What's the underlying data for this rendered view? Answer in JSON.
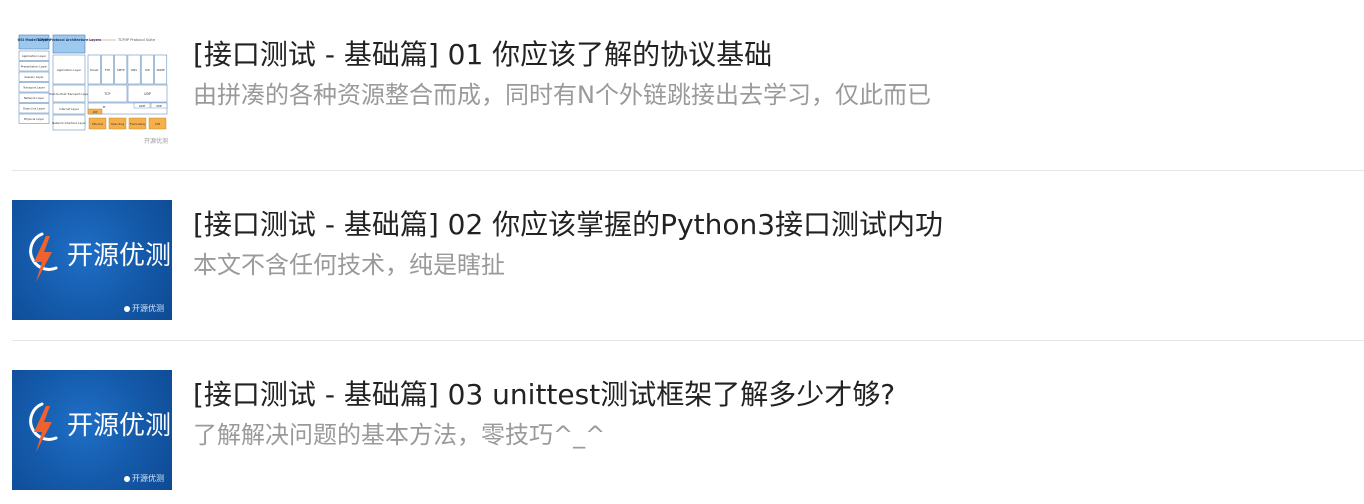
{
  "articles": [
    {
      "title": "[接口测试 - 基础篇] 01 你应该了解的协议基础",
      "description": "由拼凑的各种资源整合而成，同时有N个外链跳接出去学习，仅此而已",
      "thumbnail": {
        "kind": "protocol-diagram",
        "osi_header": "OSI Model Layers",
        "tcpip_header": "TCP/IP Protocol Architecture Layers",
        "suite_header": "TCP/IP Protocol Suite",
        "watermark": "开源优测",
        "osi_layers": [
          "Application Layer",
          "Presentation Layer",
          "Session Layer",
          "Transport Layer",
          "Network Layer",
          "Data-Link Layer",
          "Physical Layer"
        ],
        "tcpip_layers": [
          "Application Layer",
          "Host-to-Host Transport Layer",
          "Internet Layer",
          "Network Interface Layer"
        ],
        "app_protocols": [
          "Telnet",
          "FTP",
          "SMTP",
          "DNS",
          "RIP",
          "SNMP"
        ],
        "transport_protocols": [
          "TCP",
          "UDP"
        ],
        "internet_protocols": [
          "IP",
          "IGMP",
          "ICMP",
          "ARP"
        ],
        "link_protocols": [
          "Ethernet",
          "Token Ring",
          "Frame Relay",
          "ATM"
        ]
      }
    },
    {
      "title": "[接口测试 - 基础篇] 02 你应该掌握的Python3接口测试内功",
      "description": "本文不含任何技术，纯是瞎扯",
      "thumbnail": {
        "kind": "brand",
        "brand_name": "开源优测",
        "tag": "开源优测"
      }
    },
    {
      "title": "[接口测试 - 基础篇] 03 unittest测试框架了解多少才够?",
      "description": "了解解决问题的基本方法，零技巧^_^",
      "thumbnail": {
        "kind": "brand",
        "brand_name": "开源优测",
        "tag": "开源优测"
      }
    }
  ],
  "colors": {
    "title": "#222222",
    "description": "#9a9a9a",
    "divider": "#e5e5e5",
    "brand_blue": "#1459a9",
    "bolt_orange": "#f0622d",
    "diagram_header": "#9ec9ef",
    "diagram_link": "#f5b04a"
  }
}
